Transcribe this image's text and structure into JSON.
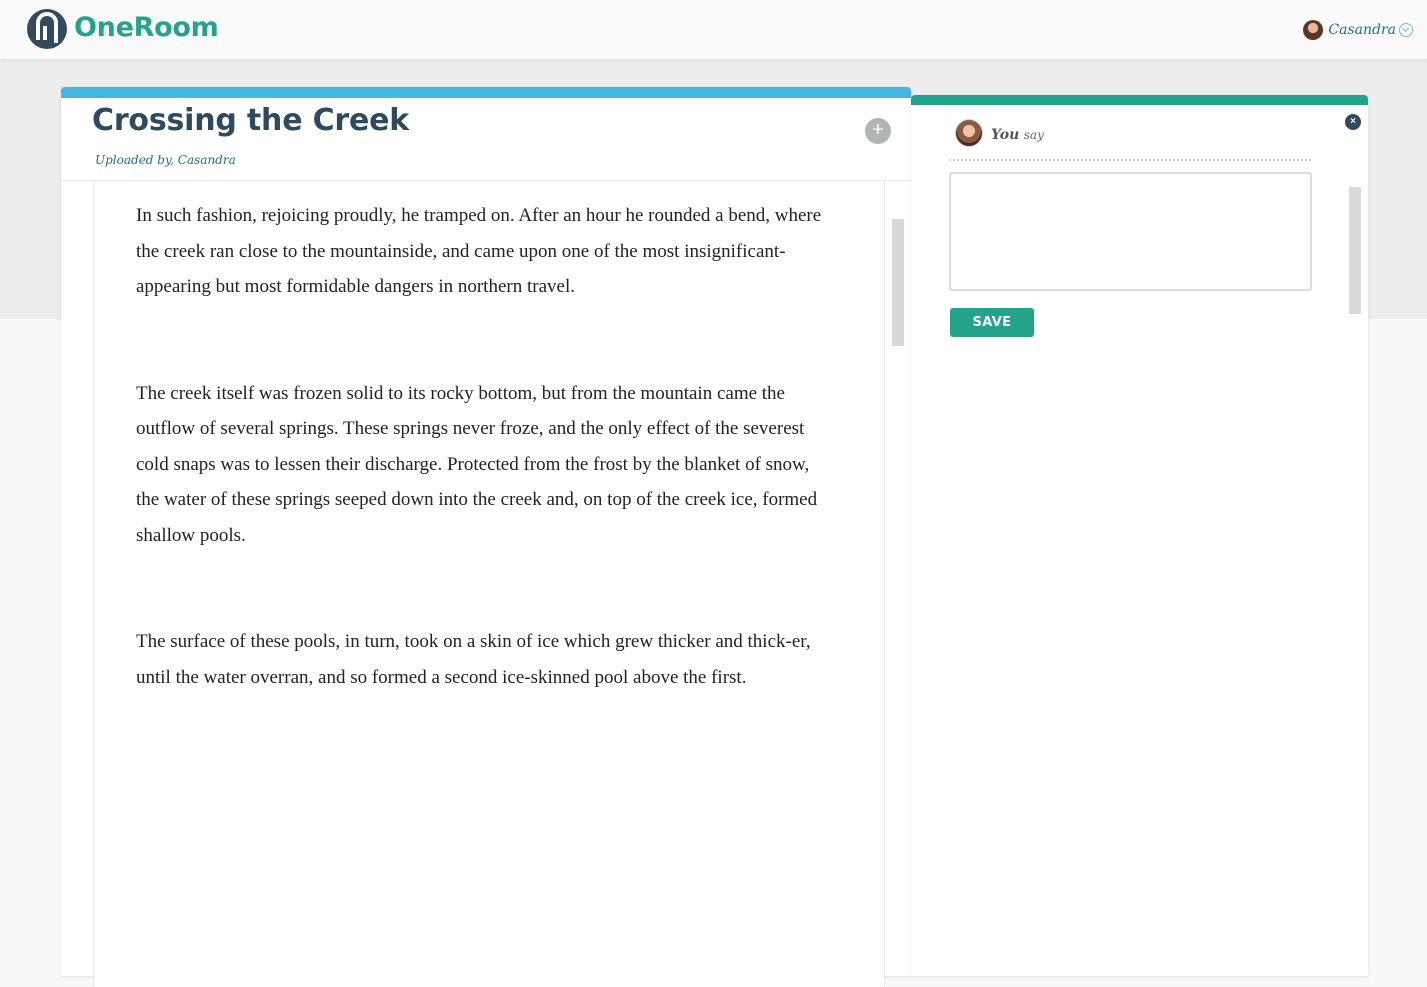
{
  "app": {
    "name": "OneRoom"
  },
  "user": {
    "name": "Casandra"
  },
  "document": {
    "title": "Crossing the Creek",
    "uploaded_prefix": "Uploaded by, ",
    "uploaded_by": "Casandra",
    "paragraphs": [
      "In such fashion, rejoicing proudly, he tramped on. After an hour he rounded a bend, where the creek ran close to the mountainside, and came upon one of the most insignificant-appearing but most formidable dangers in northern travel.",
      "The creek itself was frozen solid to its rocky bottom, but from the mountain came the outflow of several springs. These springs never froze, and the only effect of the severest cold snaps was to lessen their discharge. Protected from the frost by the blanket of snow, the water of these springs seeped down into the creek and, on top of the creek ice, formed shallow pools.",
      "The surface of these pools, in turn, took on a skin of ice which grew thicker and thick-er, until the water overran, and so formed a second ice-skinned pool above the first."
    ]
  },
  "comment": {
    "author": "You",
    "verb": "say",
    "text": "",
    "save_label": "SAVE"
  },
  "icons": {
    "add": "plus-icon",
    "close": "close-icon",
    "menu": "chevron-down-icon"
  },
  "colors": {
    "brand_teal": "#23a38a",
    "doc_accent": "#44b6e3",
    "title_navy": "#2f4a5d",
    "link_blue": "#1d6f8c"
  }
}
